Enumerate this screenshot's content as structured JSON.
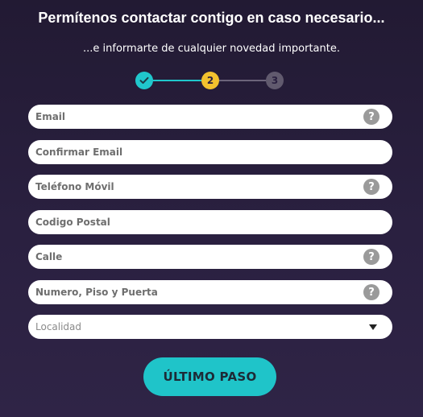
{
  "header": {
    "title": "Permítenos contactar contigo en caso necesario...",
    "subtitle": "...e informarte de cualquier novedad importante."
  },
  "stepper": {
    "current_step": 2,
    "steps": [
      {
        "label": "",
        "state": "completed"
      },
      {
        "label": "2",
        "state": "active"
      },
      {
        "label": "3",
        "state": "pending"
      }
    ]
  },
  "form": {
    "email": {
      "placeholder": "Email",
      "value": ""
    },
    "confirm_email": {
      "placeholder": "Confirmar Email",
      "value": ""
    },
    "phone": {
      "placeholder": "Teléfono Móvil",
      "value": ""
    },
    "postal_code": {
      "placeholder": "Codigo Postal",
      "value": ""
    },
    "street": {
      "placeholder": "Calle",
      "value": ""
    },
    "number": {
      "placeholder": "Numero, Piso y Puerta",
      "value": ""
    },
    "locality": {
      "selected": "Localidad"
    },
    "help_glyph": "?"
  },
  "actions": {
    "submit_label": "ÚLTIMO PASO"
  },
  "colors": {
    "background": "#2a2040",
    "accent_teal": "#1fc4c9",
    "accent_yellow": "#f2c12e",
    "step_pending": "#615a6e",
    "help_icon": "#9a9a9a"
  },
  "icons": {
    "step_done": "check-icon",
    "help": "help-icon",
    "select": "caret-down-icon"
  }
}
